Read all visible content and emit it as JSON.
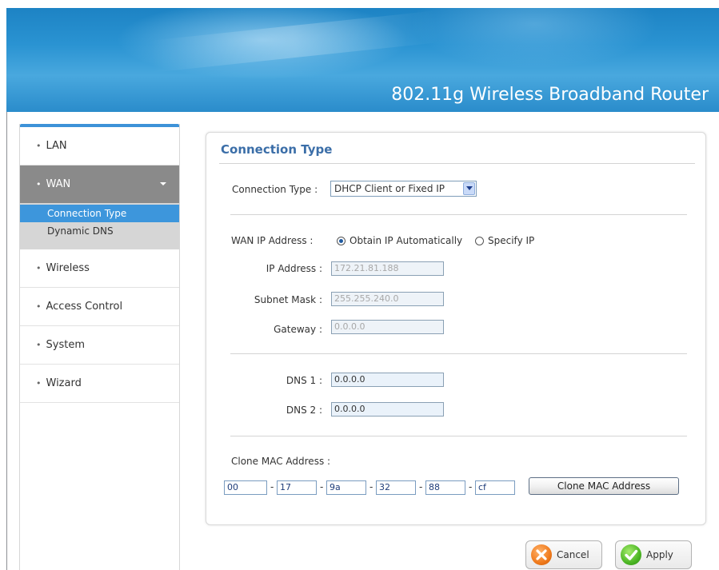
{
  "header": {
    "title": "802.11g Wireless Broadband Router"
  },
  "sidebar": {
    "items": [
      {
        "label": "LAN"
      },
      {
        "label": "WAN",
        "sub": [
          "Connection Type",
          "Dynamic DNS"
        ]
      },
      {
        "label": "Wireless"
      },
      {
        "label": "Access Control"
      },
      {
        "label": "System"
      },
      {
        "label": "Wizard"
      }
    ],
    "bullet": "•"
  },
  "panel": {
    "title": "Connection Type",
    "connection_type": {
      "label": "Connection Type :",
      "value": "DHCP Client or Fixed IP"
    },
    "wan_ip": {
      "label": "WAN IP Address :",
      "option_auto": "Obtain IP Automatically",
      "option_specify": "Specify IP",
      "ip_label": "IP Address :",
      "ip_value": "172.21.81.188",
      "mask_label": "Subnet Mask :",
      "mask_value": "255.255.240.0",
      "gw_label": "Gateway :",
      "gw_value": "0.0.0.0"
    },
    "dns": {
      "dns1_label": "DNS 1 :",
      "dns1_value": "0.0.0.0",
      "dns2_label": "DNS 2 :",
      "dns2_value": "0.0.0.0"
    },
    "mac": {
      "label": "Clone MAC Address :",
      "octets": [
        "00",
        "17",
        "9a",
        "32",
        "88",
        "cf"
      ],
      "separator": "-",
      "button": "Clone MAC Address"
    }
  },
  "actions": {
    "cancel": "Cancel",
    "apply": "Apply"
  },
  "colors": {
    "accent": "#3d96dc",
    "title": "#3b6ea8",
    "active_nav": "#8a8a8a"
  }
}
